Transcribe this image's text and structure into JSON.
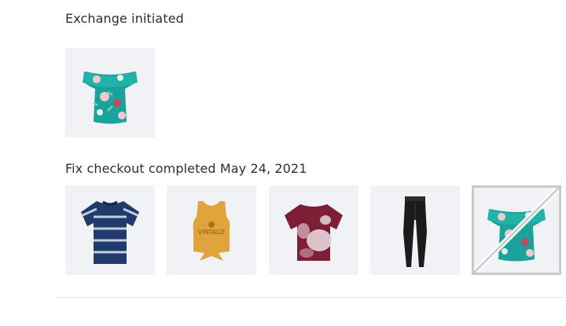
{
  "exchange": {
    "heading": "Exchange initiated",
    "items": [
      {
        "name": "teal floral off-shoulder top",
        "icon": "floral-top-icon",
        "color": "#1aa39a"
      }
    ]
  },
  "checkout": {
    "heading": "Fix checkout completed May 24, 2021",
    "items": [
      {
        "name": "navy tie-dye tee",
        "icon": "tie-dye-tee-icon",
        "color": "#1f3a6b"
      },
      {
        "name": "mustard knotted tank",
        "icon": "tank-top-icon",
        "color": "#e0a43c"
      },
      {
        "name": "burgundy tie-dye tee",
        "icon": "burgundy-tee-icon",
        "color": "#7b1e36"
      },
      {
        "name": "black leggings",
        "icon": "leggings-icon",
        "color": "#1b1b1b"
      },
      {
        "name": "teal floral off-shoulder top (returned)",
        "icon": "floral-top-icon",
        "color": "#1aa39a",
        "returned": true
      }
    ]
  }
}
